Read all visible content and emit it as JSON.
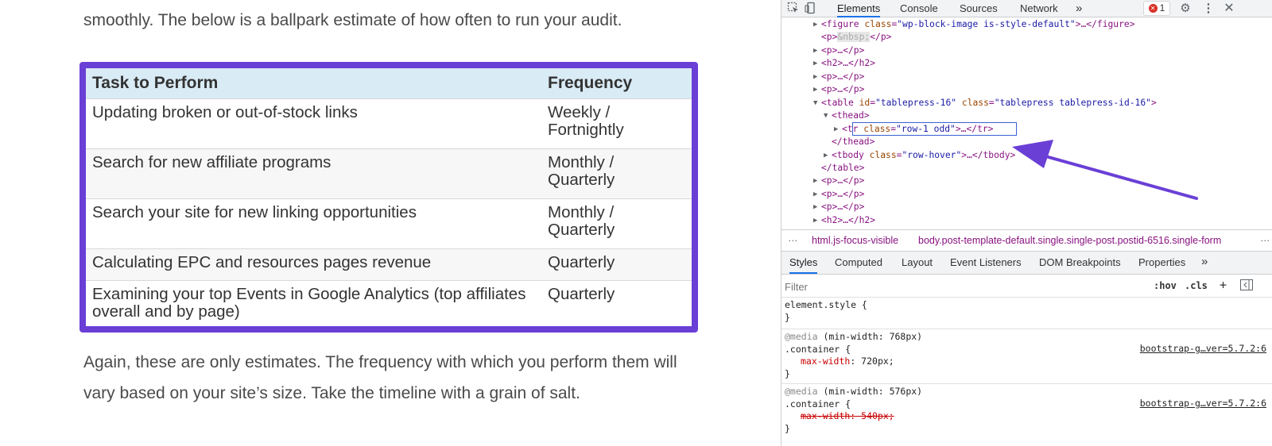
{
  "article": {
    "intro": "smoothly. The below is a ballpark estimate of how often to run your audit.",
    "table": {
      "headers": [
        "Task to Perform",
        "Frequency"
      ],
      "rows": [
        {
          "task": "Updating broken or out-of-stock links",
          "freq": "Weekly / Fortnightly"
        },
        {
          "task": "Search for new affiliate programs",
          "freq": "Monthly / Quarterly"
        },
        {
          "task": "Search your site for new linking opportunities",
          "freq": "Monthly / Quarterly"
        },
        {
          "task": "Calculating EPC and resources pages revenue",
          "freq": "Quarterly"
        },
        {
          "task": "Examining your top Events in Google Analytics (top affiliates overall and by page)",
          "freq": "Quarterly"
        }
      ]
    },
    "outro": "Again, these are only estimates. The frequency with which you perform them will vary based on your site’s size. Take the timeline with a grain of salt.",
    "highlight_color": "#6a3fd6"
  },
  "devtools": {
    "tabs": [
      "Elements",
      "Console",
      "Sources",
      "Network"
    ],
    "more_tabs": "»",
    "error_count": "1",
    "icons": {
      "inspect": "inspect-icon",
      "device": "device-toolbar-icon",
      "settings": "gear-icon",
      "menu": "kebab-menu-icon",
      "close": "close-icon"
    },
    "dom": {
      "l0_tag": "<figure",
      "l0_attr": "class",
      "l0_val": "\"wp-block-image is-style-default\"",
      "l0_end": ">…</figure>",
      "l1_open": "<p>",
      "l1_text": "&nbsp;",
      "l1_close": "</p>",
      "p_collapsed": "<p>…</p>",
      "h2_collapsed": "<h2>…</h2>",
      "table_tag": "<table",
      "table_attr_id": "id",
      "table_id_val": "\"tablepress-16\"",
      "table_attr_class": "class",
      "table_class_val": "\"tablepress tablepress-id-16\"",
      "table_gt": ">",
      "thead_open": "<thead>",
      "tr_tag": "<tr",
      "tr_attr": "class",
      "tr_val": "\"row-1 odd\"",
      "tr_end": ">…</tr>",
      "thead_close": "</thead>",
      "tbody_tag": "<tbody",
      "tbody_attr": "class",
      "tbody_val": "\"row-hover\"",
      "tbody_end": ">…</tbody>",
      "table_close": "</table>"
    },
    "breadcrumbs": [
      "html.js-focus-visible",
      "body.post-template-default.single.single-post.postid-6516.single-form"
    ],
    "sub_tabs": [
      "Styles",
      "Computed",
      "Layout",
      "Event Listeners",
      "DOM Breakpoints",
      "Properties"
    ],
    "filter_placeholder": "Filter",
    "filter_buttons": [
      ":hov",
      ".cls",
      "+"
    ],
    "styles": {
      "element_style": "element.style {",
      "close_brace": "}",
      "media1": "@media",
      "media1_cond": "(min-width: 768px)",
      "container_sel": ".container {",
      "prop": "max-width",
      "val1": "720px;",
      "source": "bootstrap-g…ver=5.7.2:6",
      "media2": "@media",
      "media2_cond": "(min-width: 576px)",
      "struck_decl": "max-width: 540px;"
    }
  }
}
